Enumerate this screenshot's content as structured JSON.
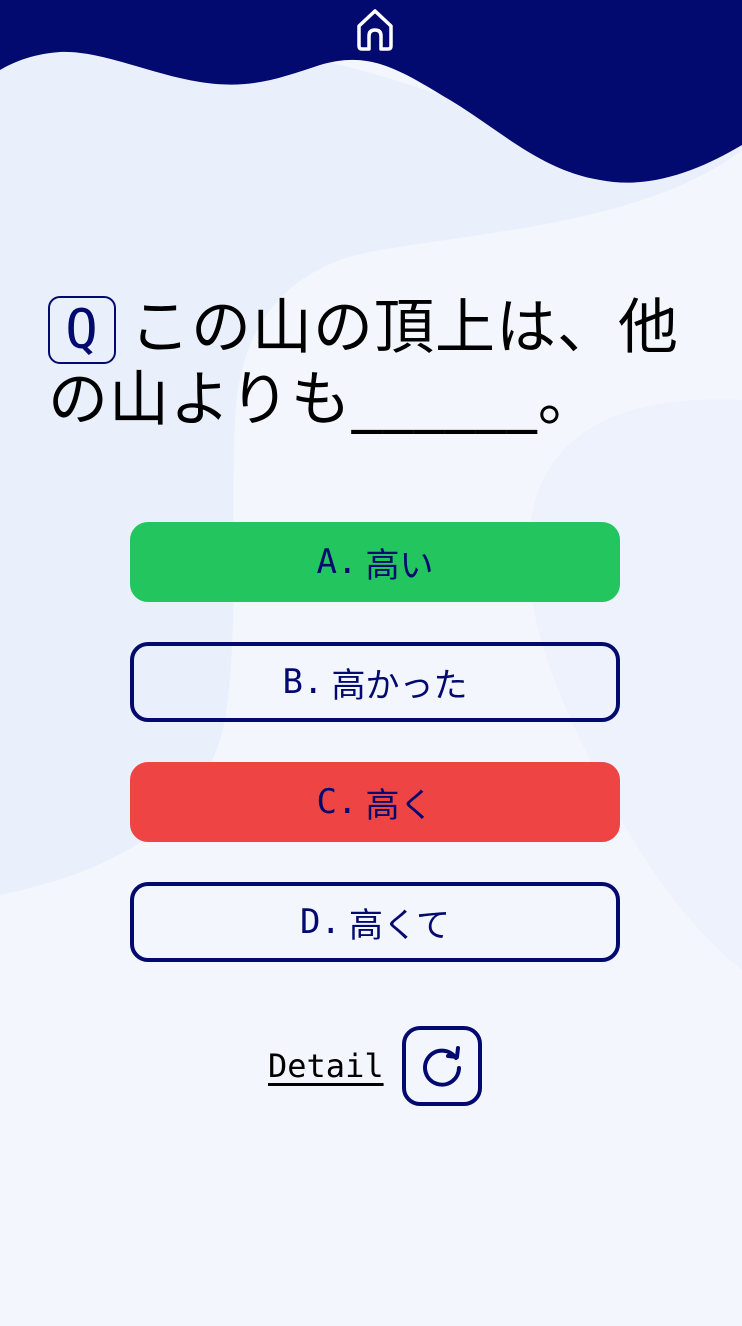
{
  "header": {
    "home_icon": "home-icon"
  },
  "question": {
    "badge": "Q",
    "text": "この山の頂上は、他の山よりも______。"
  },
  "options": [
    {
      "letter": "A.",
      "text": "高い",
      "state": "correct"
    },
    {
      "letter": "B.",
      "text": "高かった",
      "state": "default"
    },
    {
      "letter": "C.",
      "text": "高く",
      "state": "wrong"
    },
    {
      "letter": "D.",
      "text": "高くて",
      "state": "default"
    }
  ],
  "footer": {
    "detail_label": "Detail",
    "retry_icon": "refresh-icon"
  },
  "colors": {
    "header_navy": "#030A6F",
    "correct": "#22C55E",
    "wrong": "#EF4444",
    "background": "#F3F6FD"
  }
}
